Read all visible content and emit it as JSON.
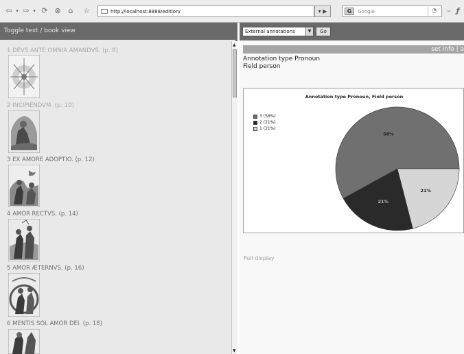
{
  "browser": {
    "url": "http://localhost:8888/edition/",
    "search_placeholder": "Google",
    "search_engine_letter": "G"
  },
  "left_panel": {
    "header": "Toggle text / book view",
    "entries": [
      {
        "title": "1 DEVS ANTE OMNIA AMANDVS. (p. 8)"
      },
      {
        "title": "2 INCIPIENDVM. (p. 10)"
      },
      {
        "title": "3 EX AMORE ADOPTIO. (p. 12)"
      },
      {
        "title": "4 AMOR RECTVS. (p. 14)"
      },
      {
        "title": "5 AMOR ÆTERNVS. (p. 16)"
      },
      {
        "title": "6 MENTIS SOL AMOR DEI. (p. 18)"
      }
    ]
  },
  "right_panel": {
    "dropdown_value": "External annotations",
    "go_label": "Go",
    "set_info": "set info | a",
    "annotation_type": "Annotation type Pronoun",
    "field": "Field person",
    "full_display": "Full display"
  },
  "colors": {
    "slice_3": "#707070",
    "slice_2": "#2a2a2a",
    "slice_1": "#d6d6d6",
    "header_bg": "#6a6a6a"
  },
  "chart_data": {
    "type": "pie",
    "title": "Annotation type Pronoun, Field person",
    "slices": [
      {
        "label": "3",
        "legend": "3 (58%)",
        "value": 58,
        "data_label": "58%"
      },
      {
        "label": "2",
        "legend": "2 (21%)",
        "value": 21,
        "data_label": "21%"
      },
      {
        "label": "1",
        "legend": "1 (21%)",
        "value": 21,
        "data_label": "21%"
      }
    ],
    "legend_position": "top-left"
  }
}
